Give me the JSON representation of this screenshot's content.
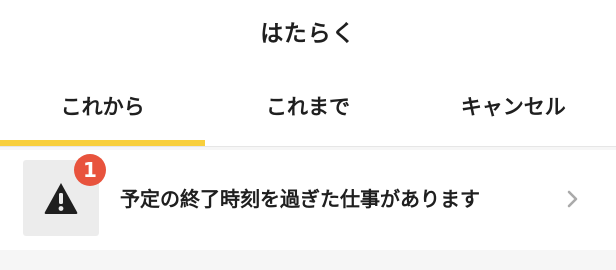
{
  "header": {
    "title": "はたらく"
  },
  "tabs": [
    {
      "label": "これから",
      "selected": true
    },
    {
      "label": "これまで",
      "selected": false
    },
    {
      "label": "キャンセル",
      "selected": false
    }
  ],
  "notice": {
    "icon": "warning-icon",
    "badge_count": "1",
    "message": "予定の終了時刻を過ぎた仕事があります",
    "chevron": "chevron-right-icon"
  },
  "colors": {
    "accent": "#f8cf3c",
    "badge": "#e8533d",
    "text": "#1f1f1f",
    "background": "#f6f6f6"
  }
}
